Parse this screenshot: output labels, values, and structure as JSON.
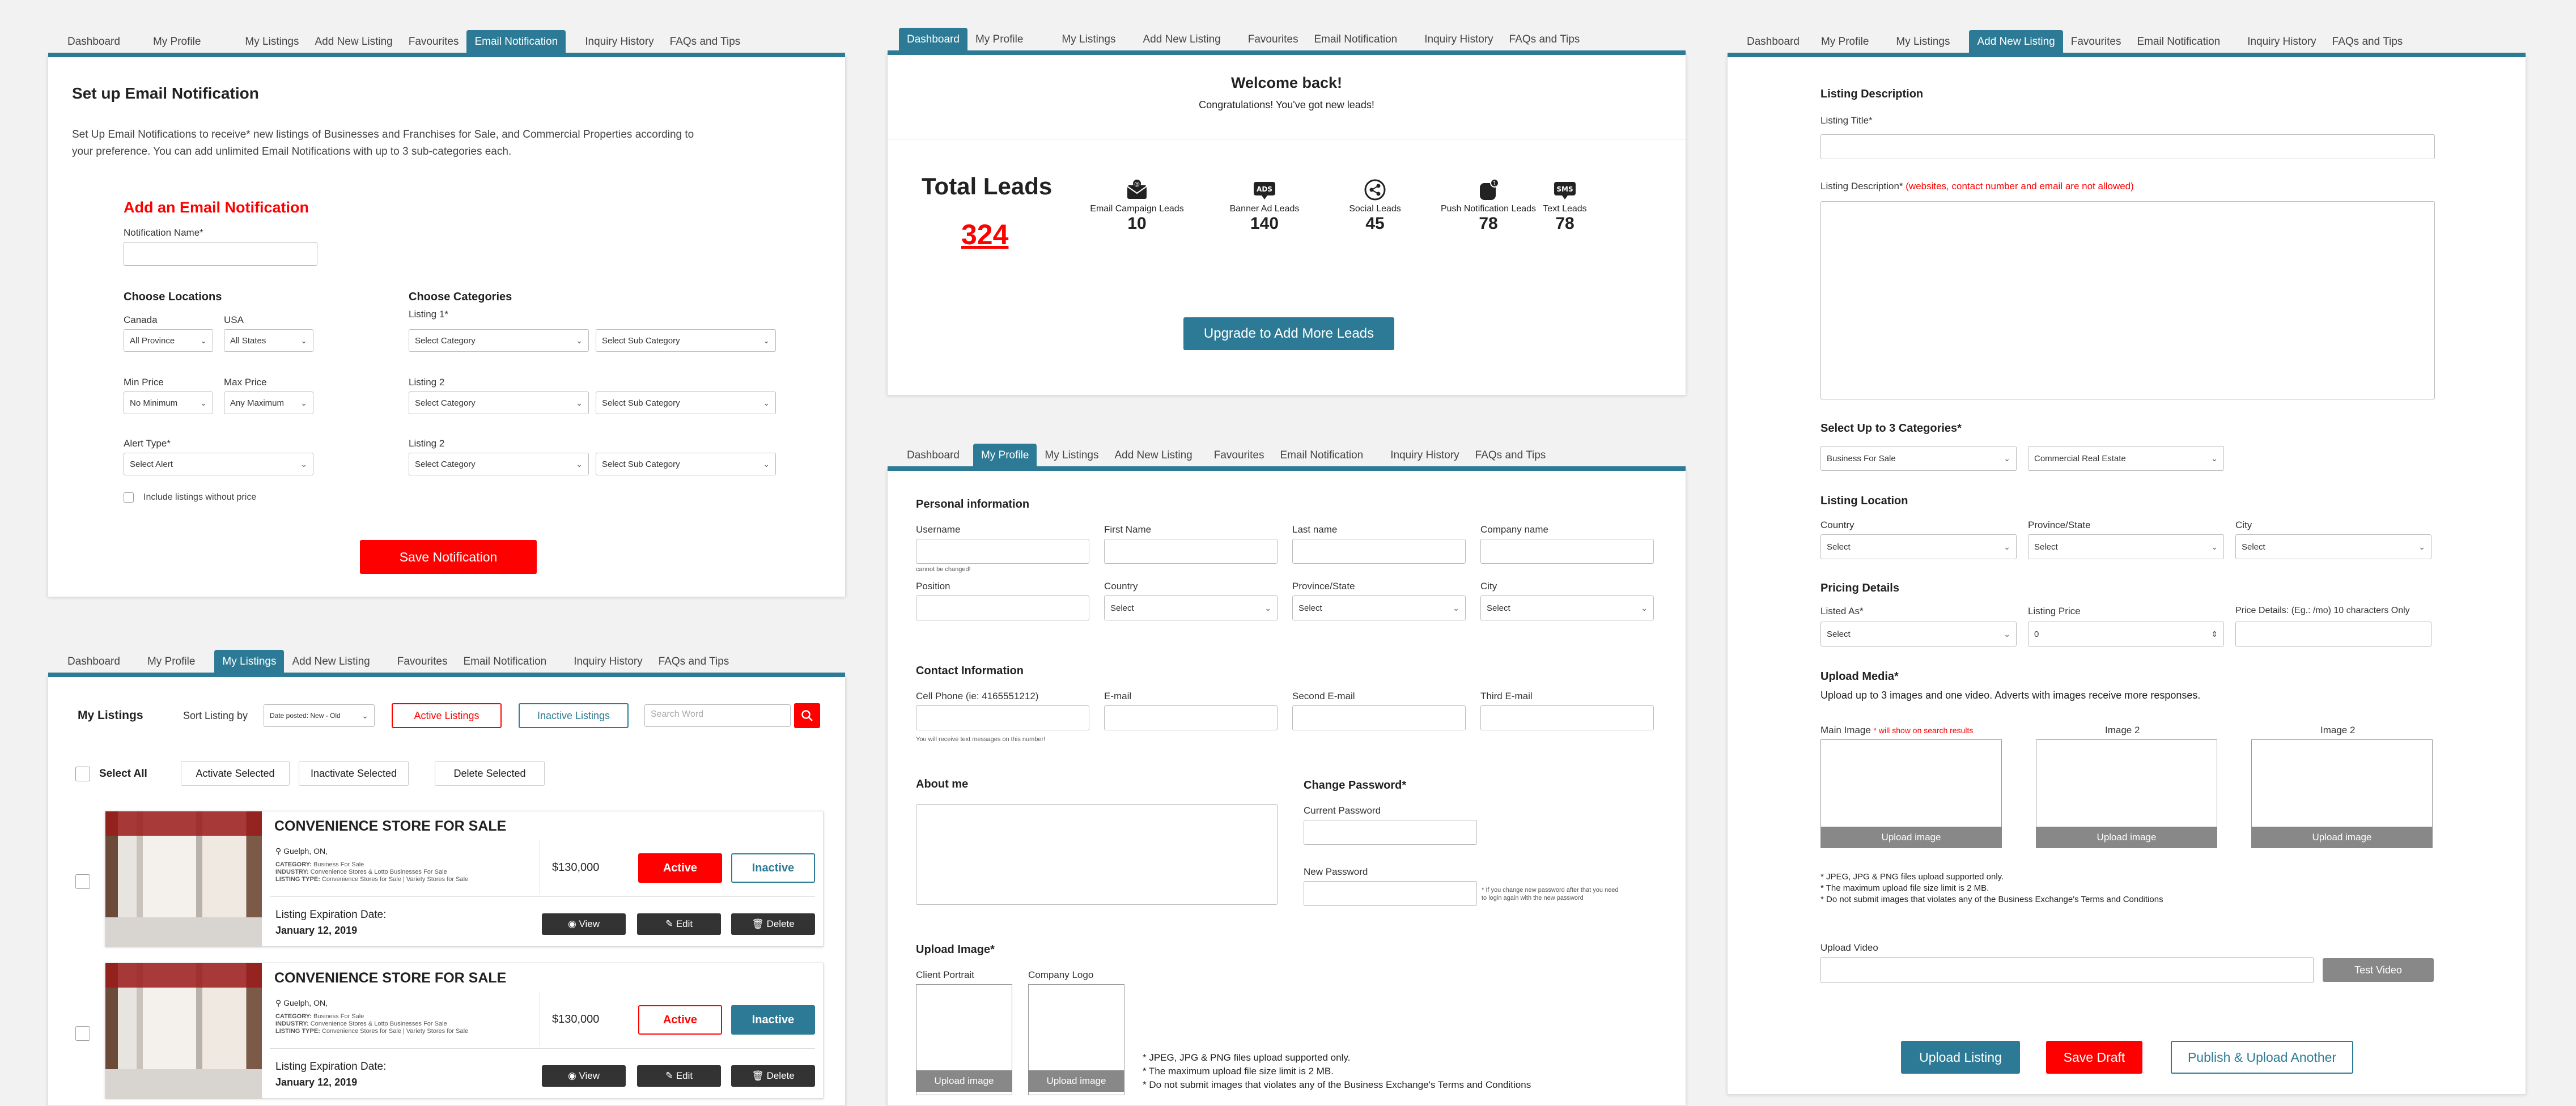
{
  "tabs": [
    "Dashboard",
    "My Profile",
    "My Listings",
    "Add New Listing",
    "Favourites",
    "Email Notification",
    "Inquiry History",
    "FAQs and Tips"
  ],
  "email": {
    "title": "Set up Email Notification",
    "intro1": "Set Up Email Notifications to receive* new listings of Businesses and Franchises for Sale, and Commercial Properties according to",
    "intro2": "your preference. You can add unlimited Email Notifications with up to 3 sub-categories each.",
    "add_title": "Add an Email Notification",
    "name_label": "Notification Name*",
    "locations": "Choose Locations",
    "canada": "Canada",
    "usa": "USA",
    "all_province": "All Province",
    "all_states": "All States",
    "min_price": "Min Price",
    "max_price": "Max Price",
    "no_minimum": "No Minimum",
    "any_maximum": "Any Maximum",
    "alert_type": "Alert Type*",
    "select_alert": "Select Alert",
    "include": "Include listings without price",
    "categories": "Choose Categories",
    "listing1": "Listing 1*",
    "listing2": "Listing 2",
    "listing3": "Listing 2",
    "select_category": "Select Category",
    "select_sub": "Select Sub Category",
    "save": "Save Notification"
  },
  "listings": {
    "title": "My Listings",
    "sort_label": "Sort Listing by",
    "sort_value": "Date posted: New - Old",
    "active_btn": "Active Listings",
    "inactive_btn": "Inactive Listings",
    "search_placeholder": "Search Word",
    "select_all": "Select All",
    "activate": "Activate Selected",
    "inactivate": "Inactivate Selected",
    "delete": "Delete Selected",
    "items": [
      {
        "title": "CONVENIENCE STORE FOR SALE",
        "location": "Guelph, ON,",
        "category": "Business For Sale",
        "industry": "Convenience Stores & Lotto Businesses For Sale",
        "type": "Convenience Stores for Sale | Variety Stores for Sale",
        "price": "$130,000",
        "exp_label": "Listing Expiration Date:",
        "exp_date": "January 12, 2019",
        "status": "active"
      },
      {
        "title": "CONVENIENCE STORE FOR SALE",
        "location": "Guelph, ON,",
        "category": "Business For Sale",
        "industry": "Convenience Stores & Lotto Businesses For Sale",
        "type": "Convenience Stores for Sale | Variety Stores for Sale",
        "price": "$130,000",
        "exp_label": "Listing Expiration Date:",
        "exp_date": "January 12, 2019",
        "status": "inactive"
      }
    ],
    "labels": {
      "category": "CATEGORY:",
      "industry": "INDUSTRY:",
      "type": "LISTING TYPE:",
      "active": "Active",
      "inactive": "Inactive",
      "view": "View",
      "edit": "Edit",
      "delete": "Delete"
    }
  },
  "dashboard": {
    "welcome": "Welcome back!",
    "congrats": "Congratulations! You've got new leads!",
    "total_label": "Total Leads",
    "total": "324",
    "stats": [
      {
        "label": "Email Campaign Leads",
        "value": "10",
        "icon": "email-campaign-icon"
      },
      {
        "label": "Banner Ad Leads",
        "value": "140",
        "icon": "ads-icon"
      },
      {
        "label": "Social Leads",
        "value": "45",
        "icon": "share-icon"
      },
      {
        "label": "Push Notification Leads",
        "value": "78",
        "icon": "push-notification-icon"
      },
      {
        "label": "Text Leads",
        "value": "78",
        "icon": "sms-icon"
      }
    ],
    "upgrade": "Upgrade to Add More Leads"
  },
  "profile": {
    "personal": "Personal information",
    "username": "Username",
    "first": "First Name",
    "last": "Last name",
    "company": "Company name",
    "cannot": "cannot be changed!",
    "position": "Position",
    "country": "Country",
    "province": "Province/State",
    "city": "City",
    "select": "Select",
    "contact": "Contact Information",
    "cell": "Cell Phone (ie: 4165551212)",
    "email": "E-mail",
    "second": "Second E-mail",
    "third": "Third E-mail",
    "cell_note": "You will receive text messages on this number!",
    "about": "About me",
    "change_pw": "Change Password*",
    "current_pw": "Current Password",
    "new_pw": "New Password",
    "pw_note1": "* If you change new password after that you need",
    "pw_note2": "to login again with the new password",
    "upload_image": "Upload Image*",
    "client": "Client Portrait",
    "logo": "Company Logo",
    "upload_btn": "Upload image",
    "notes": [
      "* JPEG, JPG & PNG files upload supported only.",
      "* The maximum upload file size limit is 2 MB.",
      "* Do not submit images that violates any of the Business Exchange's Terms and Conditions"
    ]
  },
  "newlisting": {
    "desc_title": "Listing Description",
    "title_label": "Listing Title*",
    "desc_label": "Listing Description*",
    "desc_warn": "(websites, contact number and email are not allowed)",
    "cats": "Select Up to 3 Categories*",
    "cat1": "Business For Sale",
    "cat2": "Commercial Real Estate",
    "location": "Listing Location",
    "country": "Country",
    "province": "Province/State",
    "city": "City",
    "select": "Select",
    "pricing": "Pricing Details",
    "listed_as": "Listed As*",
    "listing_price": "Listing Price",
    "price_value": "0",
    "price_details": "Price Details: (Eg.: /mo) 10 characters Only",
    "media": "Upload Media*",
    "media_note": "Upload up to 3 images and one video. Adverts with images receive more responses.",
    "main_image": "Main Image",
    "main_note": "* will show on search results",
    "image2": "Image 2",
    "image3": "Image 2",
    "upload_btn": "Upload image",
    "notes": [
      "* JPEG, JPG & PNG files upload supported only.",
      "* The maximum upload file size limit is 2 MB.",
      "* Do not submit images that violates any of the Business Exchange's Terms and Conditions"
    ],
    "video": "Upload Video",
    "test_video": "Test Video",
    "upload_listing": "Upload Listing",
    "save_draft": "Save Draft",
    "publish_another": "Publish & Upload Another"
  }
}
